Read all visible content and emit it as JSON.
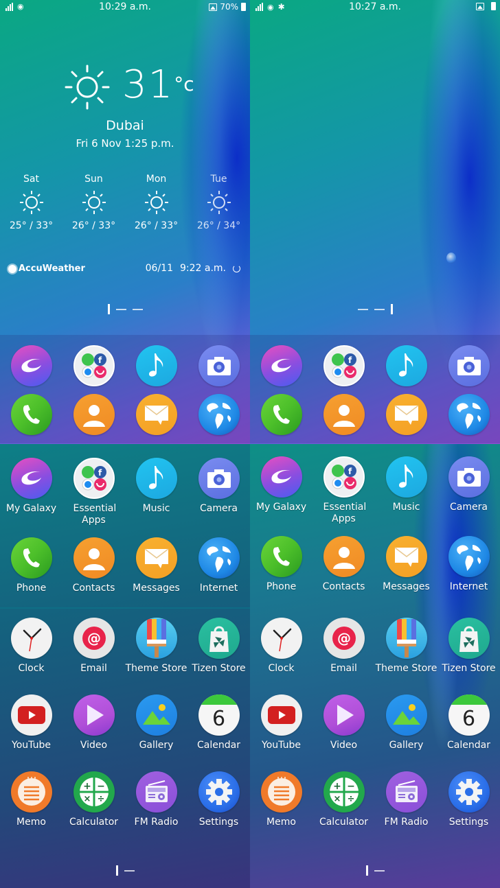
{
  "left_screen": {
    "status_bar": {
      "time": "10:29 a.m.",
      "battery_percent": "70%",
      "icons": [
        "signal-icon",
        "wifi-icon",
        "image-notification-icon",
        "battery-icon"
      ]
    },
    "weather": {
      "temperature": "31",
      "unit": "°c",
      "city": "Dubai",
      "datetime": "Fri 6 Nov 1:25 p.m.",
      "condition_icon": "sun-icon",
      "forecast": [
        {
          "day": "Sat",
          "range": "25° / 33°"
        },
        {
          "day": "Sun",
          "range": "26° / 33°"
        },
        {
          "day": "Mon",
          "range": "26° / 33°"
        },
        {
          "day": "Tue",
          "range": "26° / 34°"
        }
      ],
      "provider": "AccuWeather",
      "updated_date": "06/11",
      "updated_time": "9:22 a.m."
    },
    "home_pager": {
      "pages": 3,
      "current": 1
    },
    "drawer_pager": {
      "pages": 2,
      "current": 1
    }
  },
  "right_screen": {
    "status_bar": {
      "time": "10:27 a.m.",
      "icons": [
        "signal-icon",
        "wifi-icon",
        "bluetooth-icon",
        "image-notification-icon",
        "battery-icon"
      ]
    },
    "home_pager": {
      "pages": 3,
      "current": 3
    },
    "drawer_pager": {
      "pages": 2,
      "current": 1
    }
  },
  "dock_apps": [
    "My Galaxy",
    "Essential Apps",
    "Music",
    "Camera",
    "Phone",
    "Contacts",
    "Messages",
    "Internet"
  ],
  "apps": [
    "My Galaxy",
    "Essential Apps",
    "Music",
    "Camera",
    "Phone",
    "Contacts",
    "Messages",
    "Internet",
    "Clock",
    "Email",
    "Theme Store",
    "Tizen Store",
    "YouTube",
    "Video",
    "Gallery",
    "Calendar",
    "Memo",
    "Calculator",
    "FM Radio",
    "Settings"
  ],
  "calendar_day": "6",
  "colors": {
    "my_galaxy": "#8a4ee0",
    "music": "#1ca8e0",
    "camera": "#5a6ee0",
    "phone": "#4cbf2a",
    "contacts": "#f08a24",
    "messages": "#f4a024",
    "internet": "#1e88e5",
    "email": "#e8234a",
    "tizen_store": "#1fa88e",
    "youtube": "#d32020",
    "video": "#b04fd8",
    "gallery": "#1e7fe0",
    "calendar_top": "#3cc83c",
    "memo": "#f07a2a",
    "calculator": "#22a84c",
    "fm_radio": "#8a4fd8",
    "settings": "#2a6ee8"
  }
}
